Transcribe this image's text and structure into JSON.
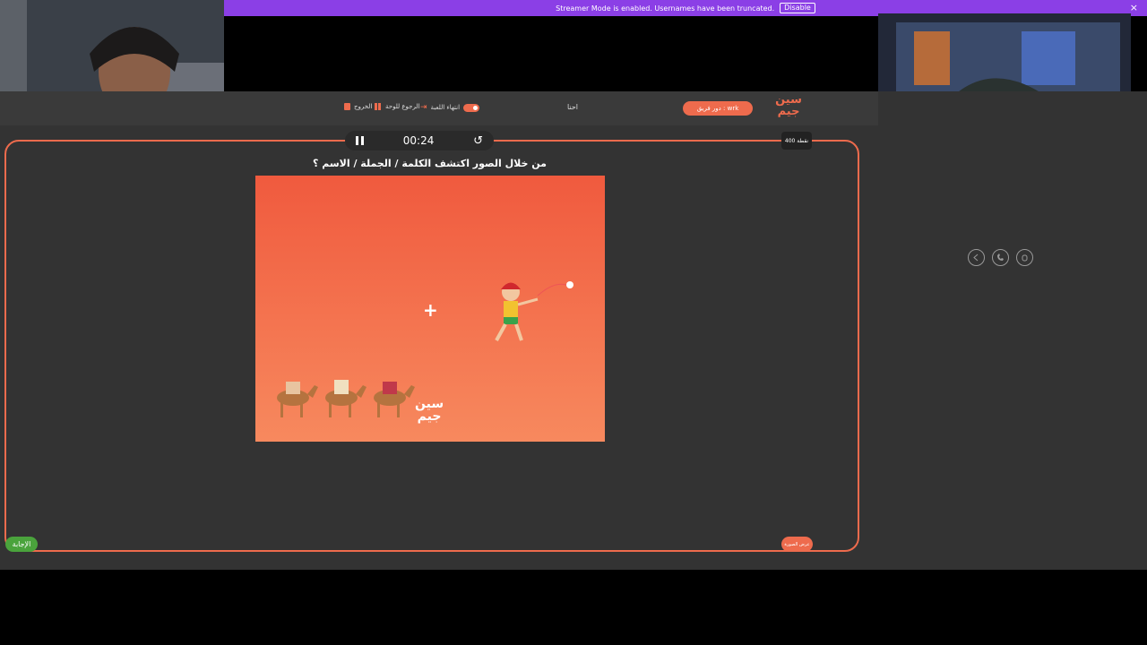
{
  "banner": {
    "message": "Streamer Mode is enabled. Usernames have been truncated.",
    "disable_label": "Disable",
    "close_glyph": "×"
  },
  "header": {
    "exit_label": "الخروج",
    "board_label": "الرجوع للوحة",
    "end_game_label": "انتهاء اللعبة",
    "player_name": "احنا",
    "turn_label": "دور فريق : wrk",
    "logo_line1": "سين",
    "logo_line2": "جيم"
  },
  "timer": {
    "time": "00:24"
  },
  "points_label": "400 نقطة",
  "question": "من خلال الصور اكتشف الكلمة / الجملة / الاسم ؟",
  "puzzle": {
    "plus": "+",
    "logo_line1": "سين",
    "logo_line2": "جيم"
  },
  "answer_label": "الإجابة",
  "show_image_label": "عرض الصورة",
  "colors": {
    "accent": "#ee6b4d",
    "banner": "#8b3fe6",
    "answer": "#4aa33c"
  }
}
